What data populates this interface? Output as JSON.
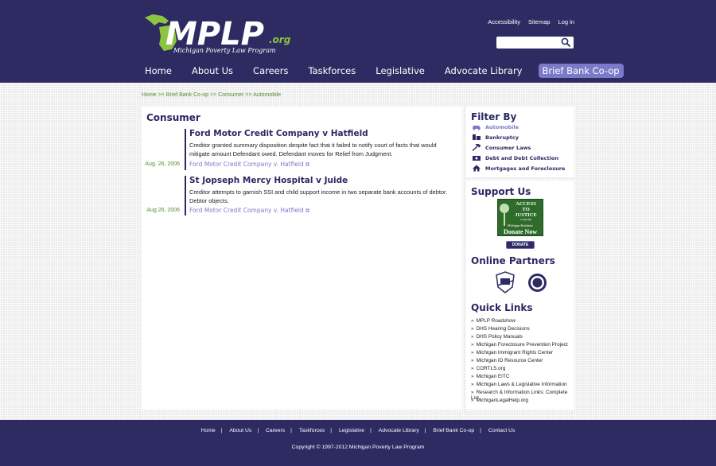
{
  "header": {
    "logo_text": "MPLP",
    "logo_suffix": ".org",
    "logo_tagline": "Michigan Poverty Law Program",
    "util_links": [
      "Accessibility",
      "Sitemap",
      "Log in"
    ],
    "search_placeholder": "",
    "nav": [
      "Home",
      "About Us",
      "Careers",
      "Taskforces",
      "Legislative",
      "Advocate Library",
      "Brief Bank Co-op"
    ],
    "nav_active": "Brief Bank Co-op"
  },
  "breadcrumb": [
    "Home",
    "Brief Bank Co-op",
    "Consumer",
    "Automobile"
  ],
  "breadcrumb_sep": " >> ",
  "main": {
    "title": "Consumer",
    "entries": [
      {
        "title": "Ford Motor Credit Company v Hatfield",
        "description": "Creditor granted summary disposition despite fact that it failed to notify court of facts that would mitigate amount Defendant owed. Defendant moves for Relief from Judgment.",
        "date": "Aug. 26, 2006",
        "link": "Ford Motor Credit Company v. Hatfield"
      },
      {
        "title": "St Jopseph Mercy Hospital v Juide",
        "description": "Creditor attempts to garnish SSI and child support income in two separate bank accounts of debtor. Debtor objects.",
        "date": "Aug 26, 2006",
        "link": "Ford Motor Credit Company v. Hatfield"
      }
    ]
  },
  "sidebar": {
    "filter_title": "Filter By",
    "filters": [
      {
        "label": "Automobile",
        "icon": "car-icon",
        "active": true
      },
      {
        "label": "Bankruptcy",
        "icon": "bankruptcy-icon",
        "active": false
      },
      {
        "label": "Consumer Laws",
        "icon": "gavel-icon",
        "active": false
      },
      {
        "label": "Debt and Debt Collection",
        "icon": "money-icon",
        "active": false
      },
      {
        "label": "Mortgages and Foreclosure",
        "icon": "house-icon",
        "active": false
      }
    ],
    "support_title": "Support Us",
    "support_banner": {
      "line1": "ACCESS",
      "line2": "TO",
      "line3": "JUSTICE",
      "line4": "Campaign",
      "line5": "Michigan Residents",
      "line6": "Donate Now"
    },
    "donate_label": "DONATE",
    "partners_title": "Online Partners",
    "quick_links_title": "Quick Links",
    "quick_links": [
      "MPLP Roadshow",
      "DHS Hearing Decisions",
      "DHS Policy Manuals",
      "Michigan Foreclosure Prevention Project",
      "Michigan Immigrant Rights Center",
      "Michigan ID Resource Center",
      "CORTLS.org",
      "Michigan EITC",
      "Michigan Laws & Legislative Information",
      "Research & Information Links: Complete List",
      "MichiganLegalHelp.org"
    ]
  },
  "footer": {
    "links": [
      "Home",
      "About Us",
      "Careers",
      "Taskforces",
      "Legislative",
      "Advocate Library",
      "Brief Bank Co-op",
      "Contact Us"
    ],
    "copyright": "Copyright © 1997-2012  Michigan Poverty Law Program"
  },
  "colors": {
    "brand_navy": "#2e2b63",
    "accent_purple": "#7c79c9",
    "accent_green": "#8cc63f",
    "breadcrumb_green": "#5a8c2e"
  }
}
